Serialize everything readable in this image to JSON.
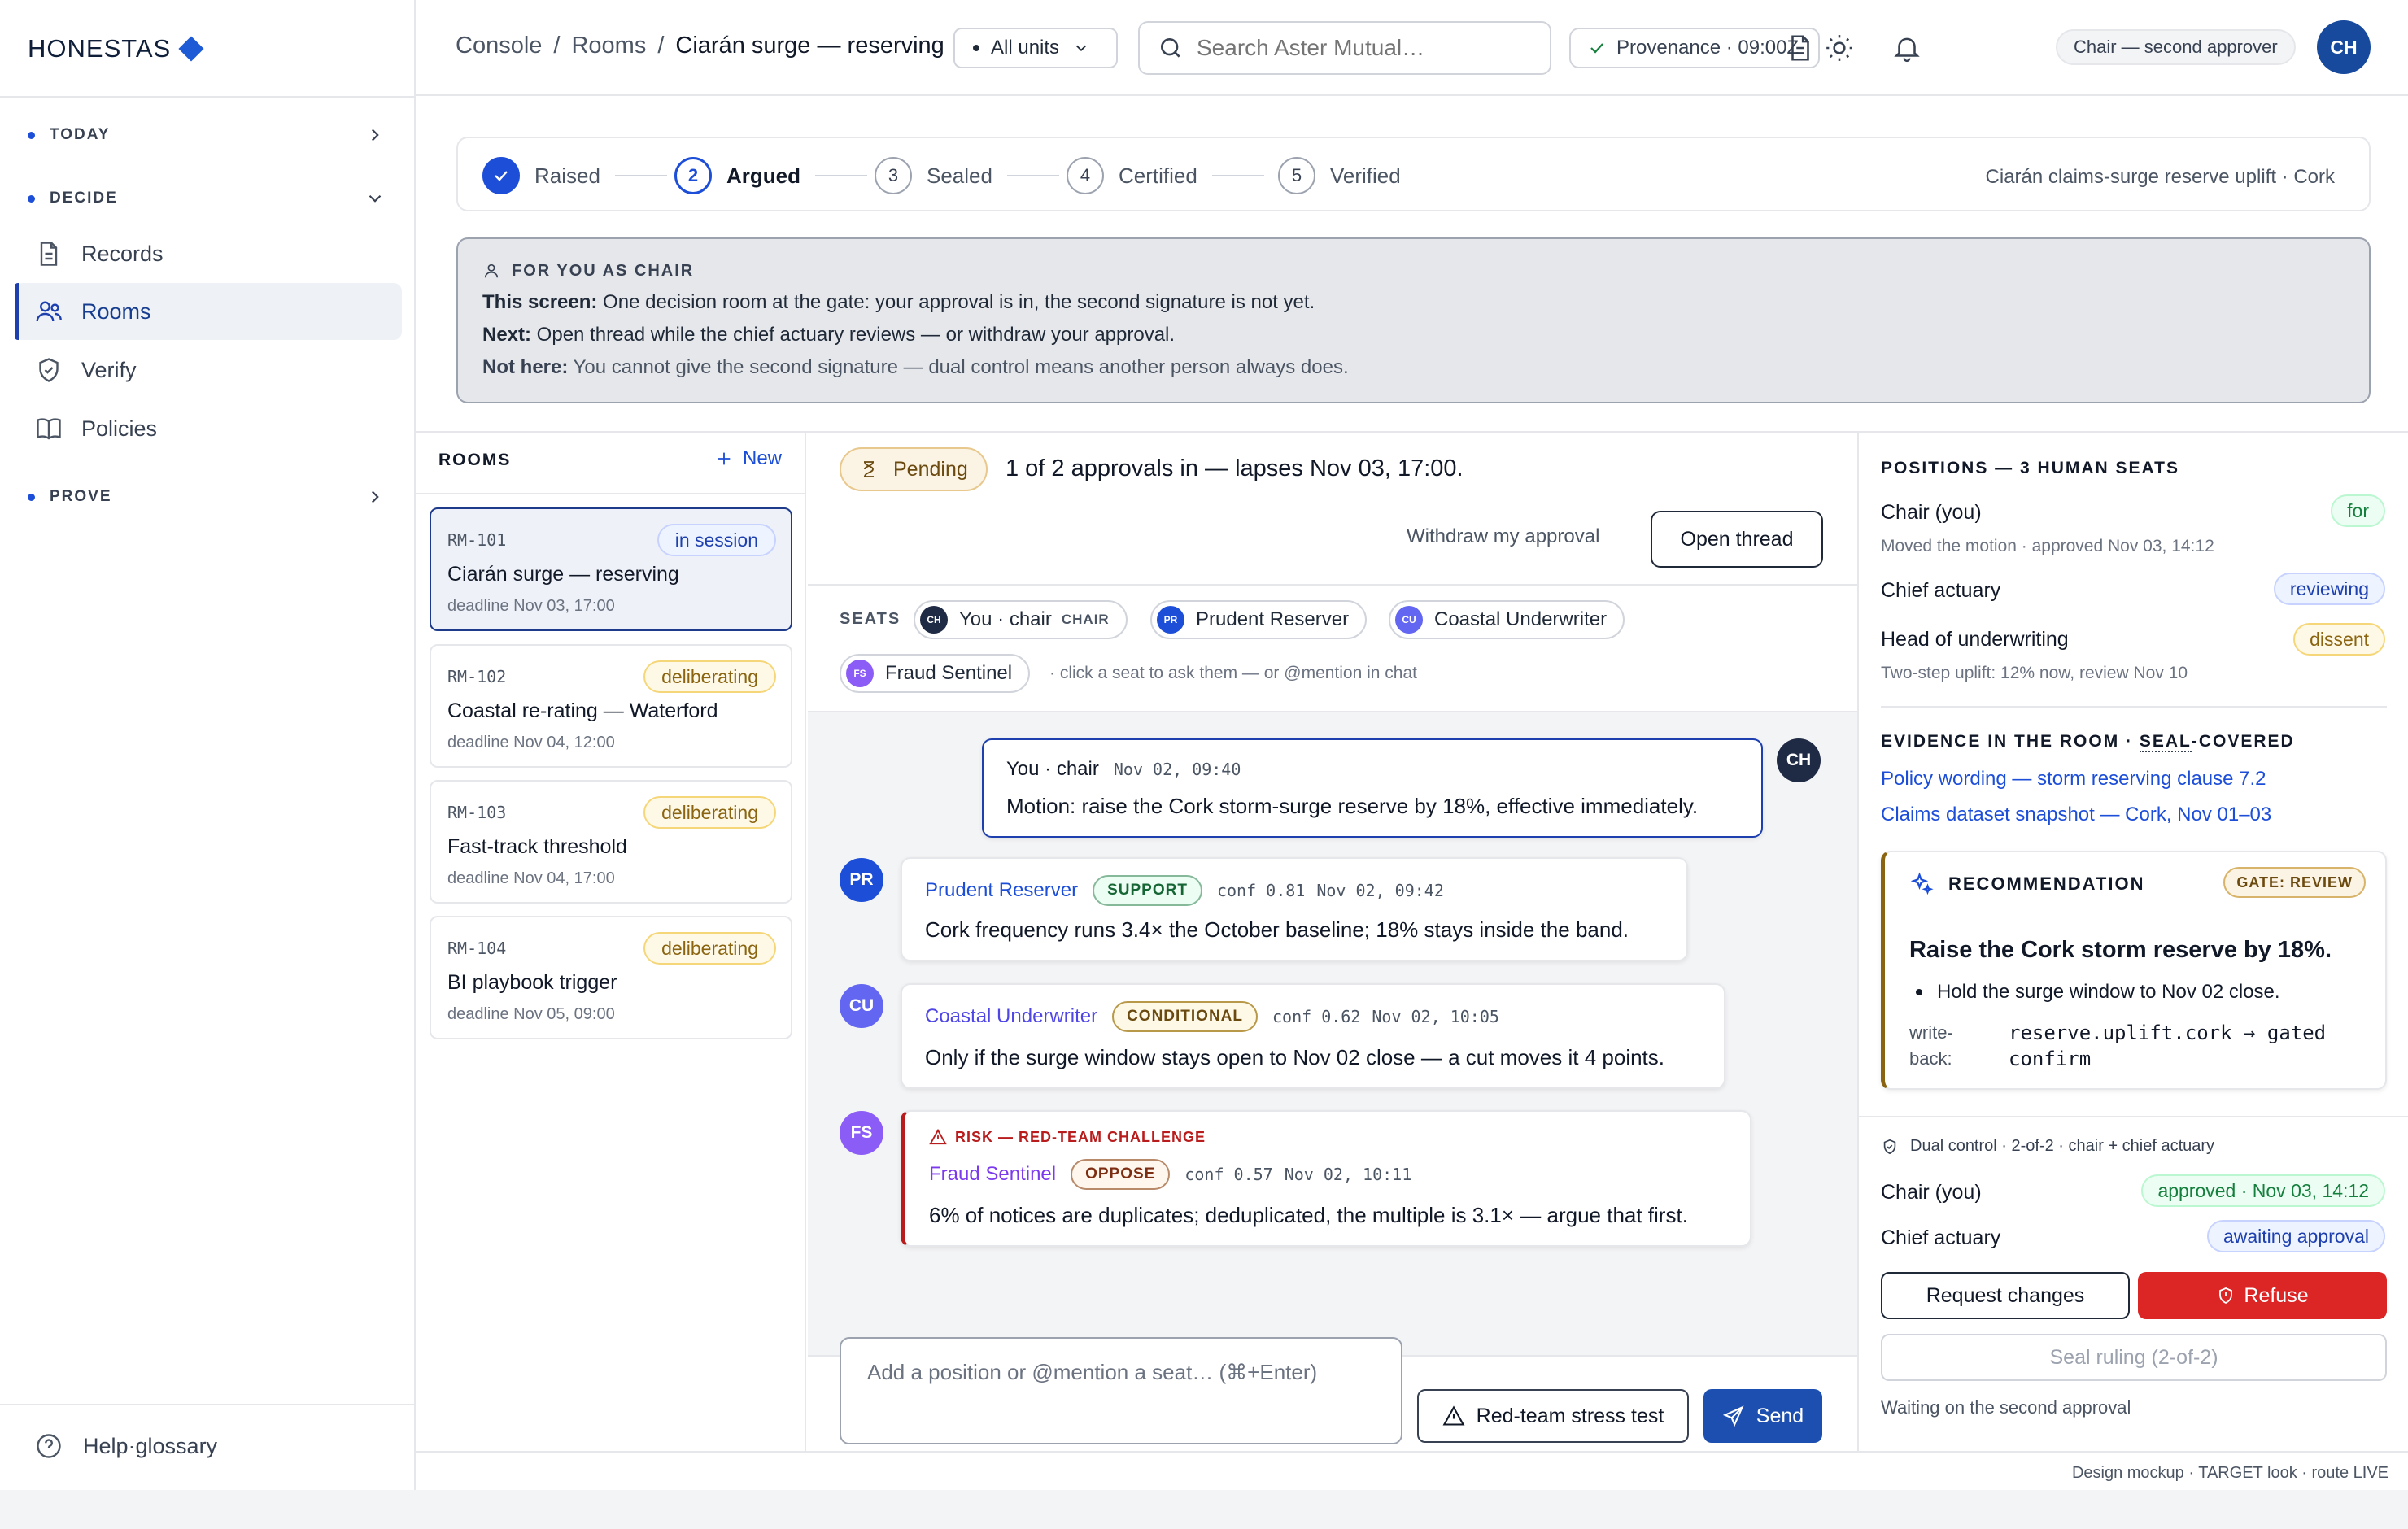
{
  "brand": {
    "name": "HONESTAS"
  },
  "sidebar": {
    "sections": [
      {
        "label": "TODAY"
      },
      {
        "label": "DECIDE"
      },
      {
        "label": "PROVE"
      }
    ],
    "items": [
      {
        "label": "Records",
        "icon": "file-icon"
      },
      {
        "label": "Rooms",
        "icon": "users-icon",
        "active": true
      },
      {
        "label": "Verify",
        "icon": "shield-check-icon"
      },
      {
        "label": "Policies",
        "icon": "book-icon"
      }
    ],
    "help_label": "Help·glossary"
  },
  "header": {
    "breadcrumb": [
      "Console",
      "/",
      "Rooms",
      "/",
      "Ciarán surge — reserving"
    ],
    "units_label": "All units",
    "search_placeholder": "Search Aster Mutual…",
    "provenance": "Provenance · 09:00Z",
    "role": "Chair — second approver",
    "avatar": "CH"
  },
  "stepper": {
    "steps": [
      {
        "num": "✓",
        "label": "Raised",
        "state": "done"
      },
      {
        "num": "2",
        "label": "Argued",
        "state": "current"
      },
      {
        "num": "3",
        "label": "Sealed",
        "state": "todo"
      },
      {
        "num": "4",
        "label": "Certified",
        "state": "todo"
      },
      {
        "num": "5",
        "label": "Verified",
        "state": "todo"
      }
    ],
    "context": "Ciarán claims-surge reserve uplift · Cork"
  },
  "guide": {
    "heading": "FOR YOU AS CHAIR",
    "lines": [
      {
        "k": "This screen:",
        "v": " One decision room at the gate: your approval is in, the second signature is not yet."
      },
      {
        "k": "Next:",
        "v": " Open thread while the chief actuary reviews — or withdraw your approval."
      },
      {
        "k": "Not here:",
        "v": " You cannot give the second signature — dual control means another person always does."
      }
    ]
  },
  "rooms": {
    "heading": "ROOMS",
    "new_label": "New",
    "list": [
      {
        "id": "RM-101",
        "name": "Ciarán surge — reserving",
        "deadline": "deadline Nov 03, 17:00",
        "status": "in session",
        "selected": true
      },
      {
        "id": "RM-102",
        "name": "Coastal re-rating — Waterford",
        "deadline": "deadline Nov 04, 12:00",
        "status": "deliberating"
      },
      {
        "id": "RM-103",
        "name": "Fast-track threshold",
        "deadline": "deadline Nov 04, 17:00",
        "status": "deliberating"
      },
      {
        "id": "RM-104",
        "name": "BI playbook trigger",
        "deadline": "deadline Nov 05, 09:00",
        "status": "deliberating"
      }
    ]
  },
  "thread": {
    "status_badge": "Pending",
    "status_text": "1 of 2 approvals in — lapses Nov 03, 17:00.",
    "withdraw_label": "Withdraw my approval",
    "open_thread_label": "Open thread",
    "seats_label": "SEATS",
    "seats": [
      {
        "initials": "CH",
        "name": "You · chair",
        "role": "CHAIR",
        "color": "#1f2a44"
      },
      {
        "initials": "PR",
        "name": "Prudent Reserver",
        "color": "#1d4ed8"
      },
      {
        "initials": "CU",
        "name": "Coastal Underwriter",
        "color": "#6366f1"
      },
      {
        "initials": "FS",
        "name": "Fraud Sentinel",
        "color": "#8b5cf6"
      }
    ],
    "seat_hint": "· click a seat to ask them — or @mention in chat",
    "messages": [
      {
        "initials": "CH",
        "who": "You · chair",
        "time": "Nov 02, 09:40",
        "body": "Motion: raise the Cork storm-surge reserve by 18%, effective immediately."
      },
      {
        "initials": "PR",
        "who": "Prudent Reserver",
        "stance": "SUPPORT",
        "conf": "conf 0.81",
        "time": "Nov 02, 09:42",
        "body": "Cork frequency runs 3.4× the October baseline; 18% stays inside the band."
      },
      {
        "initials": "CU",
        "who": "Coastal Underwriter",
        "stance": "CONDITIONAL",
        "conf": "conf 0.62",
        "time": "Nov 02, 10:05",
        "body": "Only if the surge window stays open to Nov 02 close — a cut moves it 4 points."
      },
      {
        "initials": "FS",
        "risk": "RISK — RED-TEAM CHALLENGE",
        "who": "Fraud Sentinel",
        "stance": "OPPOSE",
        "conf": "conf 0.57",
        "time": "Nov 02, 10:11",
        "body": "6% of notices are duplicates; deduplicated, the multiple is 3.1× — argue that first."
      }
    ],
    "composer_placeholder": "Add a position or @mention a seat… (⌘+Enter)",
    "redteam_label": "Red-team stress test",
    "send_label": "Send"
  },
  "positions": {
    "heading": "POSITIONS — 3 HUMAN SEATS",
    "list": [
      {
        "name": "Chair (you)",
        "sub": "Moved the motion · approved Nov 03, 14:12",
        "tag": "for"
      },
      {
        "name": "Chief actuary",
        "sub": "",
        "tag": "reviewing"
      },
      {
        "name": "Head of underwriting",
        "sub": "Two-step uplift: 12% now, review Nov 10",
        "tag": "dissent"
      }
    ]
  },
  "evidence": {
    "heading_a": "EVIDENCE IN THE ROOM · ",
    "heading_b": "SEAL",
    "heading_c": "-COVERED",
    "links": [
      "Policy wording — storm reserving clause 7.2",
      "Claims dataset snapshot — Cork, Nov 01–03"
    ]
  },
  "recommendation": {
    "heading": "RECOMMENDATION",
    "gate": "GATE: REVIEW",
    "title": "Raise the Cork storm reserve by 18%.",
    "bullet": "Hold the surge window to Nov 02 close.",
    "writeback_label": "write-back:",
    "writeback_value": "reserve.uplift.cork → gated confirm"
  },
  "dual_control": {
    "heading": "Dual control · 2-of-2 · chair + chief actuary",
    "rows": [
      {
        "name": "Chair (you)",
        "status": "approved · Nov 03, 14:12"
      },
      {
        "name": "Chief actuary",
        "status": "awaiting approval"
      }
    ],
    "request_changes": "Request changes",
    "refuse": "Refuse",
    "seal": "Seal ruling (2-of-2)",
    "waiting": "Waiting on the second approval"
  },
  "footer": {
    "text": "Design mockup · TARGET look · route LIVE"
  }
}
